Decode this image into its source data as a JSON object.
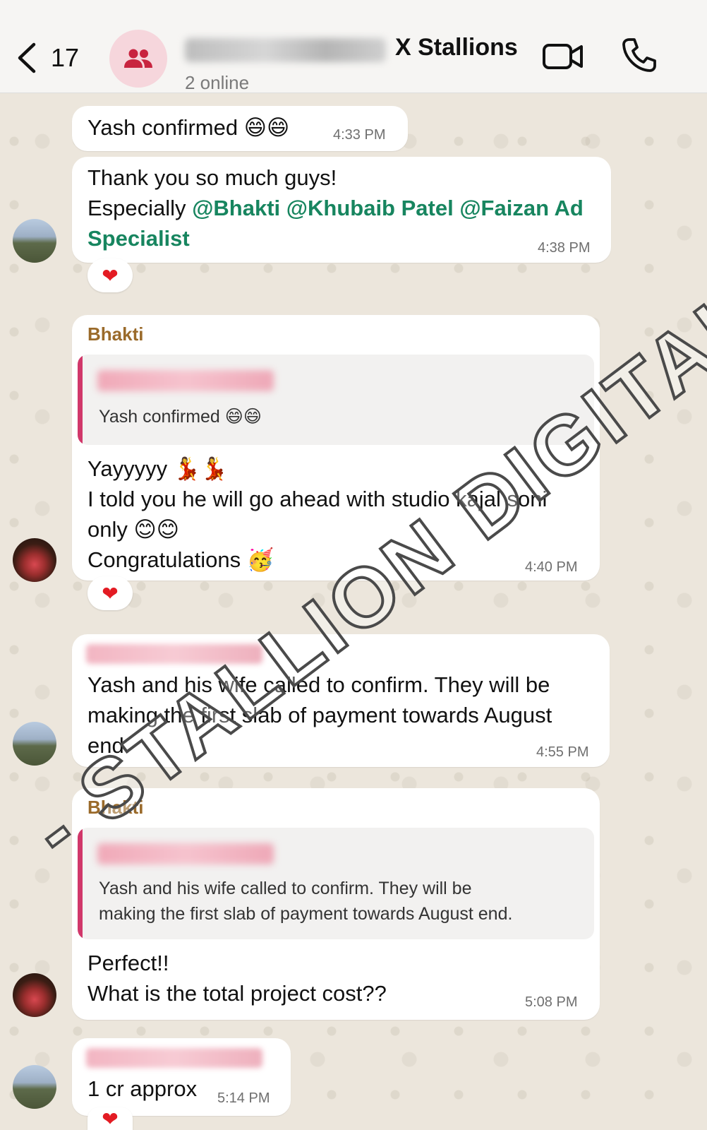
{
  "header": {
    "back_count": "17",
    "title": "X Stallions",
    "subtitle": "2 online"
  },
  "messages": [
    {
      "text": "Yash confirmed 😄😄",
      "time": "4:33 PM"
    },
    {
      "line1": "Thank you so much guys!",
      "line2_prefix": "Especially ",
      "mention1": "@Bhakti",
      "mention2": "@Khubaib Patel",
      "mention3": "@Faizan Ad",
      "mention3_cont": "Specialist",
      "time": "4:38 PM",
      "reaction": "❤"
    },
    {
      "sender": "Bhakti",
      "quote": "Yash confirmed 😄😄",
      "line1": "Yayyyyy 💃💃",
      "line2": "I told you he will go ahead with studio kajal soni",
      "line3": "only 😊😊",
      "line4": "Congratulations 🥳",
      "time": "4:40 PM",
      "reaction": "❤"
    },
    {
      "line1": "Yash and his wife called to confirm. They will be",
      "line2": "making the first slab of payment towards August",
      "line3": "end.",
      "time": "4:55 PM"
    },
    {
      "sender": "Bhakti",
      "quote_line1": "Yash and his wife called to confirm. They will be",
      "quote_line2": "making the first slab of payment towards August end.",
      "line1": "Perfect!!",
      "line2": "What is the total project cost??",
      "time": "5:08 PM"
    },
    {
      "text": "1 cr approx",
      "time": "5:14 PM",
      "reaction": "❤"
    }
  ],
  "watermark": "- STALLION DIGITAL MEDI",
  "icons": {
    "back": "chevron-left-icon",
    "group": "group-icon",
    "video": "video-call-icon",
    "call": "phone-icon"
  },
  "colors": {
    "mention": "#17855f",
    "sender": "#9a6a2a",
    "quote_bar": "#d1376a",
    "avatar_bg": "#f6d6dc"
  }
}
